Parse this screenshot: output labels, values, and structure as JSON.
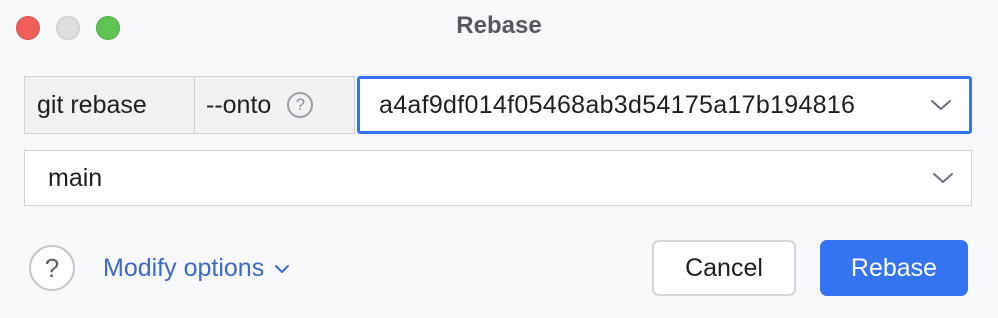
{
  "window": {
    "title": "Rebase",
    "controls": [
      "close",
      "minimize",
      "maximize"
    ]
  },
  "command": {
    "git_label": "git rebase",
    "onto_label": "--onto",
    "help_symbol": "?",
    "onto_value": "a4af9df014f05468ab3d54175a17b194816"
  },
  "branch": {
    "value": "main"
  },
  "footer": {
    "help_symbol": "?",
    "modify_options_label": "Modify options",
    "cancel_label": "Cancel",
    "rebase_label": "Rebase"
  },
  "colors": {
    "accent": "#3574f0",
    "link": "#3d6ac9",
    "close": "#ee5f57",
    "minimize": "#dedede",
    "maximize": "#5fc453"
  },
  "icons": [
    "close-icon",
    "minimize-icon",
    "maximize-icon",
    "help-icon",
    "chevron-down-icon"
  ]
}
